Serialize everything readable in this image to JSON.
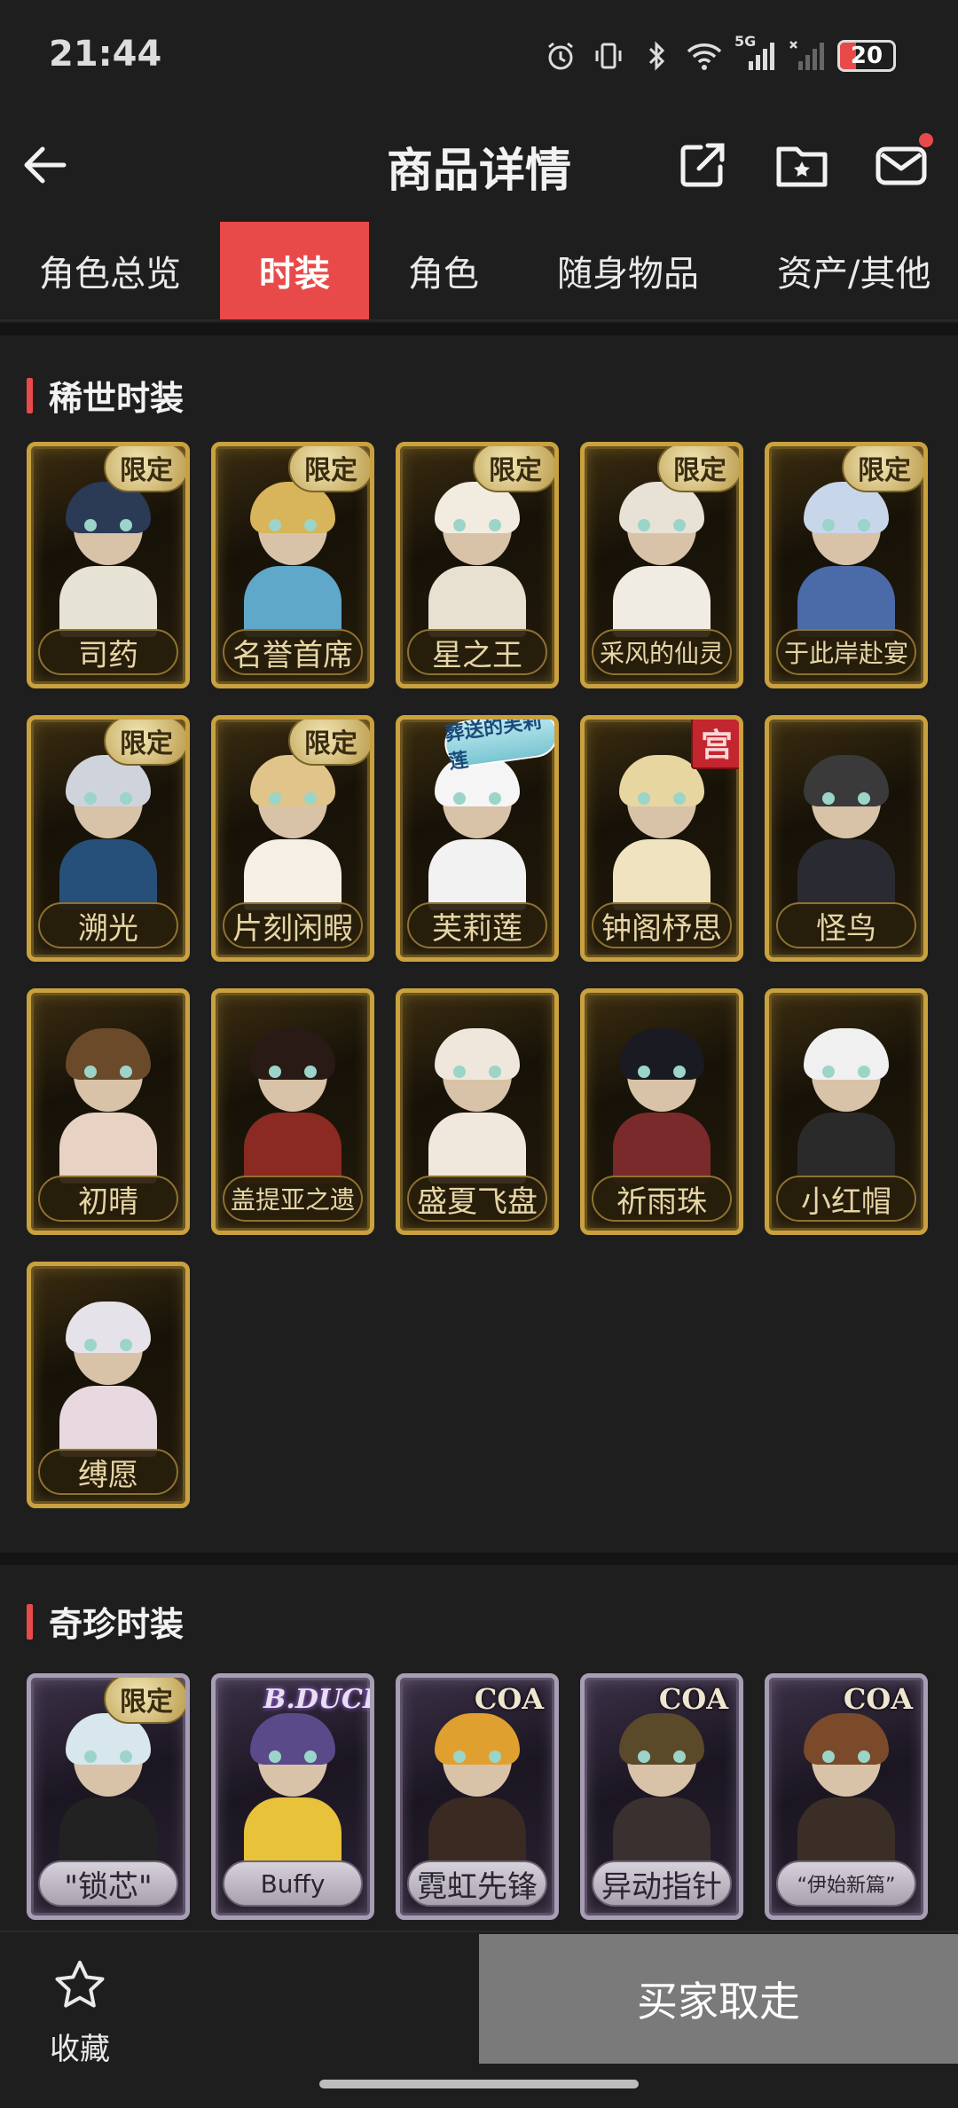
{
  "status_bar": {
    "time": "21:44",
    "network": "5G",
    "battery": "20",
    "icons": [
      "alarm-icon",
      "vibrate-icon",
      "bluetooth-icon",
      "wifi-icon",
      "signal-icon",
      "signal-x-icon",
      "battery-icon"
    ]
  },
  "header": {
    "title": "商品详情",
    "back_icon": "arrow-left-icon",
    "share_icon": "share-icon",
    "favorite_folder_icon": "star-folder-icon",
    "message_icon": "mail-icon"
  },
  "tabs": [
    {
      "label": "角色总览",
      "active": false
    },
    {
      "label": "时装",
      "active": true
    },
    {
      "label": "角色",
      "active": false
    },
    {
      "label": "随身物品",
      "active": false
    },
    {
      "label": "资产/其他",
      "active": false
    }
  ],
  "sections": [
    {
      "title": "稀世时装",
      "items": [
        {
          "name": "司药",
          "badge": "限定"
        },
        {
          "name": "名誉首席",
          "badge": "限定"
        },
        {
          "name": "星之王",
          "badge": "限定"
        },
        {
          "name": "采风的仙灵",
          "badge": "限定"
        },
        {
          "name": "于此岸赴宴",
          "badge": "限定"
        },
        {
          "name": "溯光",
          "badge": "限定"
        },
        {
          "name": "片刻闲暇",
          "badge": "限定"
        },
        {
          "name": "芙莉莲",
          "badge": "葬送的芙莉莲"
        },
        {
          "name": "钟阁杼思",
          "badge": "宫"
        },
        {
          "name": "怪鸟",
          "badge": ""
        },
        {
          "name": "初晴",
          "badge": ""
        },
        {
          "name": "盖提亚之遗",
          "badge": ""
        },
        {
          "name": "盛夏飞盘",
          "badge": ""
        },
        {
          "name": "祈雨珠",
          "badge": ""
        },
        {
          "name": "小红帽",
          "badge": ""
        },
        {
          "name": "缚愿",
          "badge": ""
        }
      ]
    },
    {
      "title": "奇珍时装",
      "items": [
        {
          "name": "\"锁芯\"",
          "badge": "限定"
        },
        {
          "name": "Buffy",
          "badge": "B.DUCK"
        },
        {
          "name": "霓虹先锋",
          "badge": "COA"
        },
        {
          "name": "异动指针",
          "badge": "COA"
        },
        {
          "name": "“伊始新篇”",
          "badge": "COA"
        }
      ]
    }
  ],
  "bottom_bar": {
    "favorite_label": "收藏",
    "favorite_icon": "star-outline-icon",
    "buy_label": "买家取走"
  },
  "colors": {
    "accent": "#e84a4a",
    "background": "#1e1e1e",
    "gold_frame": "#c9a13e",
    "purple_frame": "#a79db4",
    "button_disabled": "#7a7a7a"
  }
}
